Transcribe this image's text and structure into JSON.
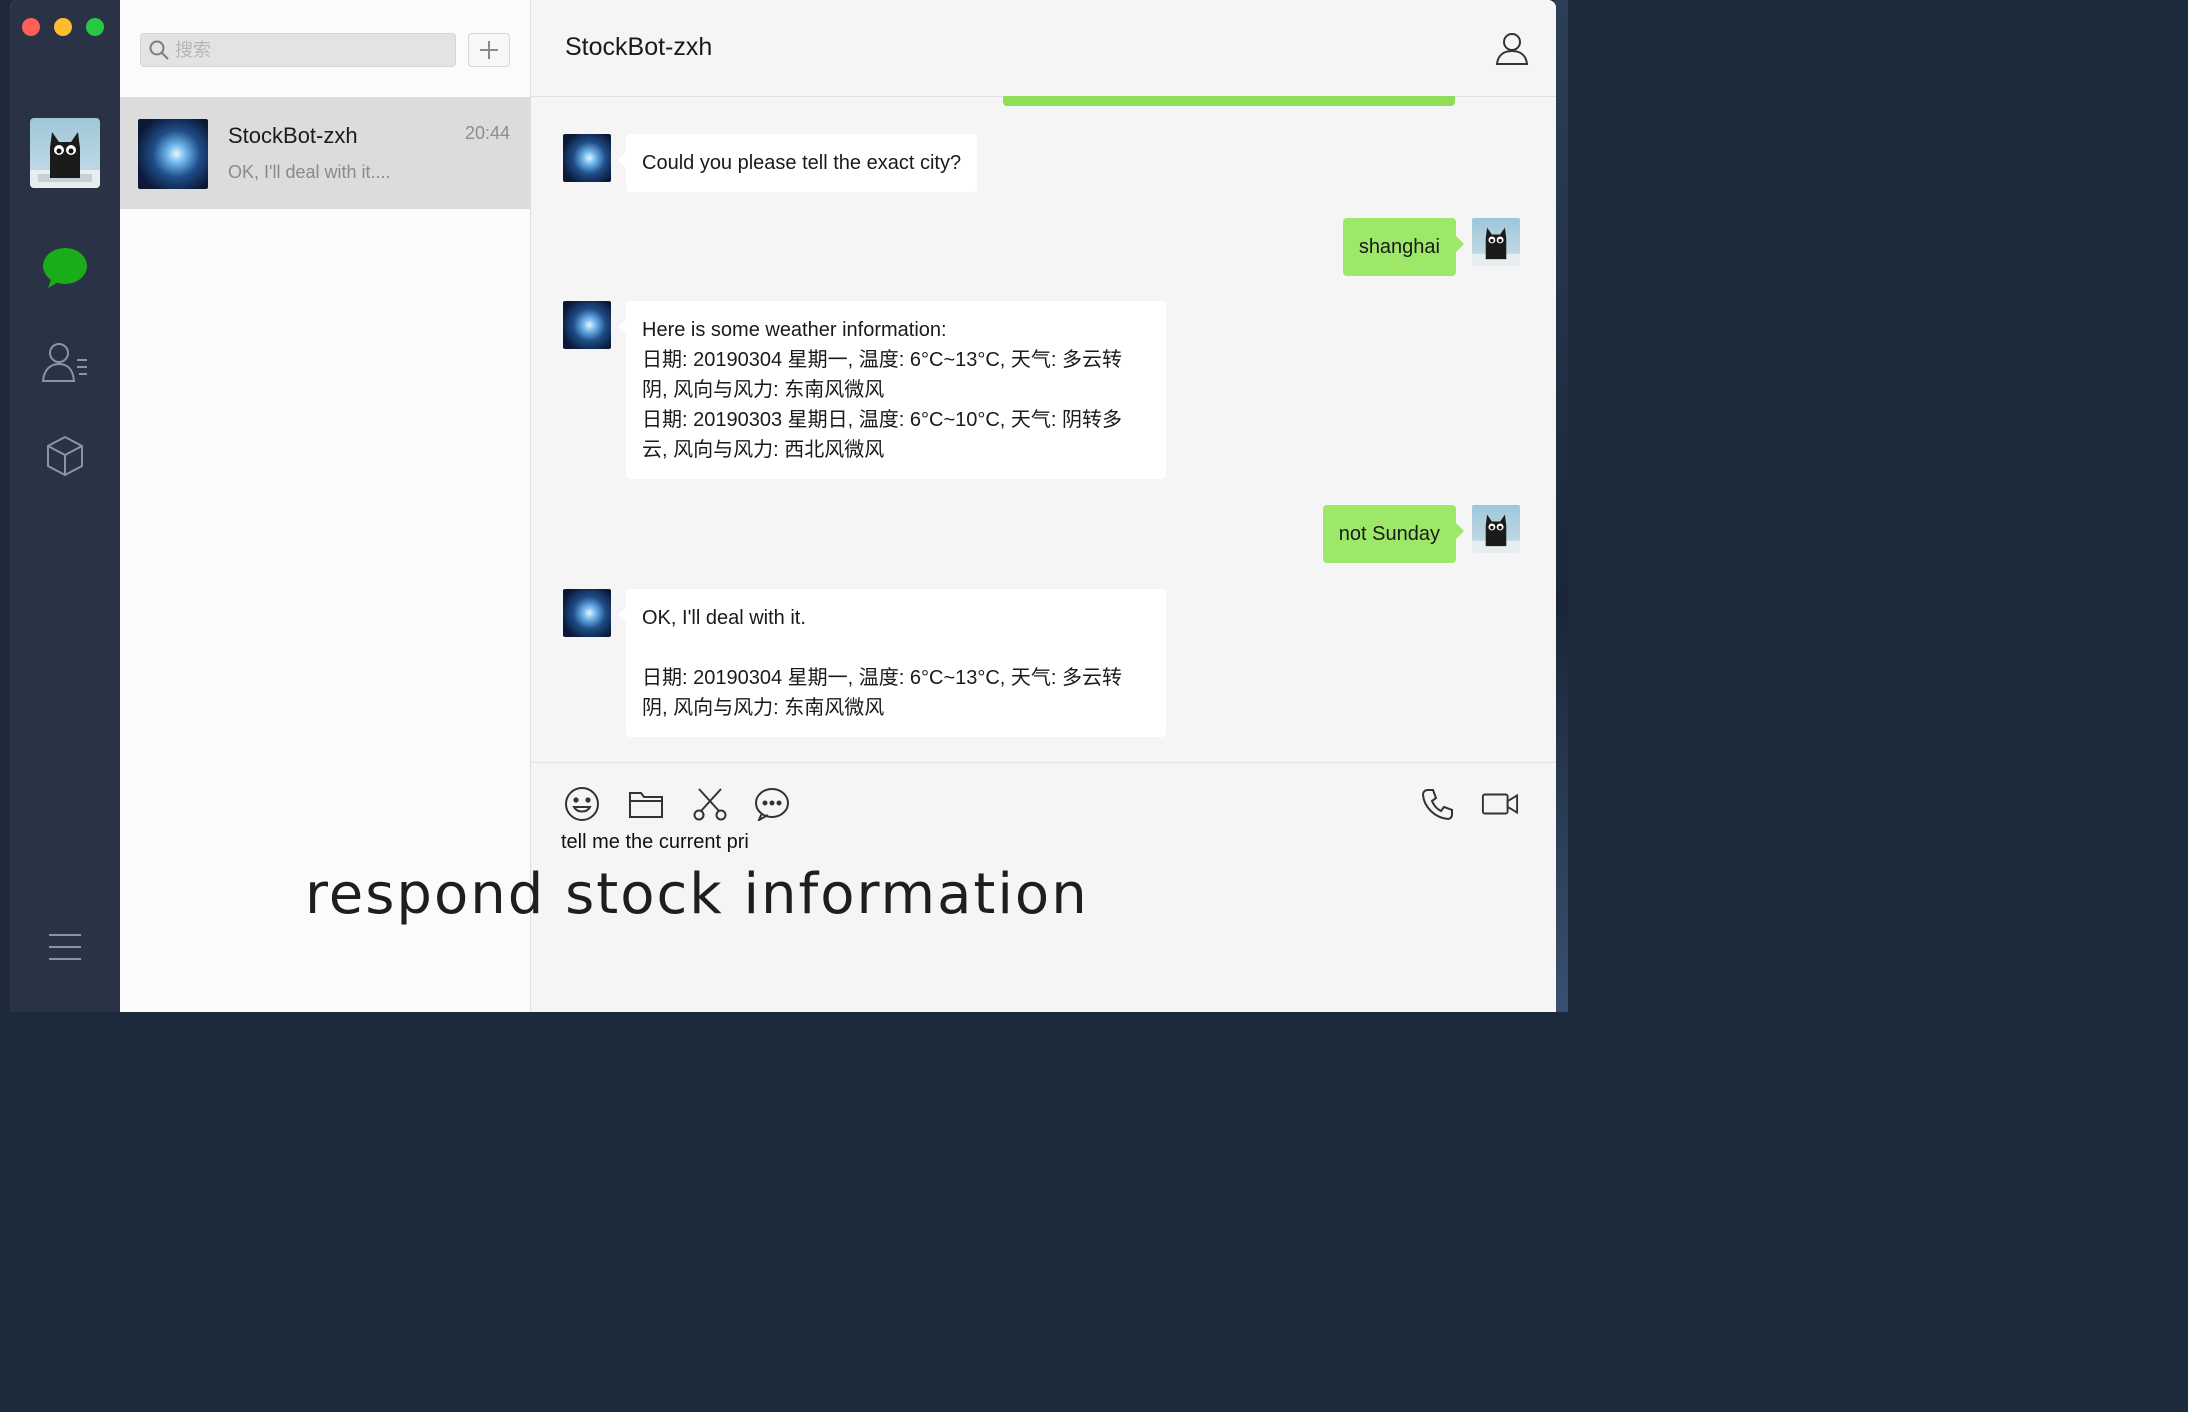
{
  "window": {
    "controls": [
      "close",
      "minimize",
      "zoom"
    ]
  },
  "rail": {
    "icons": [
      "chat-icon",
      "contacts-icon",
      "box-icon",
      "menu-icon"
    ]
  },
  "search": {
    "placeholder": "搜索"
  },
  "conversations": [
    {
      "name": "StockBot-zxh",
      "time": "20:44",
      "preview": "OK, I'll deal with it...."
    }
  ],
  "chat": {
    "title": "StockBot-zxh",
    "messages": [
      {
        "from": "bot",
        "text": "Could you please tell the exact city?"
      },
      {
        "from": "me",
        "text": "shanghai"
      },
      {
        "from": "bot",
        "text": "Here is some weather information:\n日期: 20190304 星期一, 温度: 6°C~13°C, 天气: 多云转\n阴, 风向与风力: 东南风微风\n日期: 20190303 星期日, 温度: 6°C~10°C, 天气: 阴转多\n云, 风向与风力: 西北风微风"
      },
      {
        "from": "me",
        "text": "not Sunday"
      },
      {
        "from": "bot",
        "text": "OK, I'll deal with it.\n\n日期: 20190304 星期一, 温度: 6°C~13°C, 天气: 多云转\n阴, 风向与风力: 东南风微风"
      }
    ]
  },
  "composer": {
    "text": "tell me the current pri",
    "tools": [
      "emoji-icon",
      "folder-icon",
      "scissors-icon",
      "chat-history-icon"
    ],
    "actions": [
      "phone-icon",
      "video-icon"
    ]
  },
  "caption": "respond stock information",
  "colors": {
    "sent_bubble": "#9de868",
    "received_bubble": "#ffffff",
    "rail": "#2a3346",
    "unread_green": "#1aad19"
  }
}
